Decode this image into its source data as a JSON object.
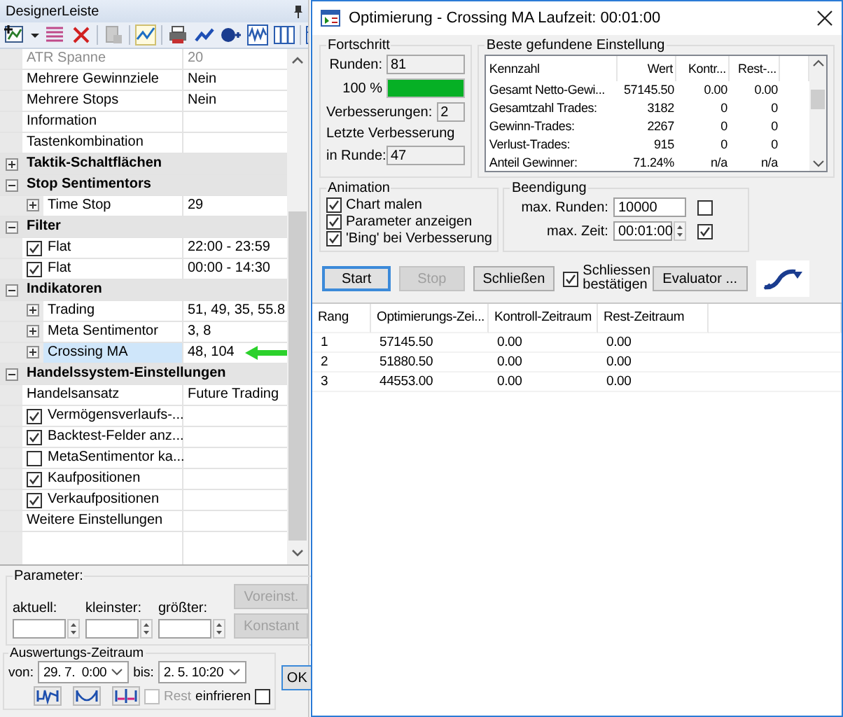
{
  "designer": {
    "title": "DesignerLeiste",
    "rows": [
      {
        "kind": "property",
        "name": "ATR Spanne",
        "value": "20",
        "disabled": true,
        "selected": false
      },
      {
        "kind": "property",
        "name": "Mehrere Gewinnziele",
        "value": "Nein",
        "disabled": false,
        "selected": false
      },
      {
        "kind": "property",
        "name": "Mehrere Stops",
        "value": "Nein",
        "disabled": false,
        "selected": false
      },
      {
        "kind": "property",
        "name": "Information",
        "disabled": false,
        "selected": false
      },
      {
        "kind": "property",
        "name": "Tastenkombination",
        "disabled": false,
        "selected": false
      },
      {
        "kind": "category",
        "label": "Taktik-Schaltflächen",
        "expanded": false
      },
      {
        "kind": "category",
        "label": "Stop Sentimentors",
        "expanded": true,
        "children": [
          {
            "kind": "expandable",
            "name": "Time Stop",
            "value": "29",
            "expanded": false,
            "selected": false,
            "pointed": false
          }
        ]
      },
      {
        "kind": "category",
        "label": "Filter",
        "expanded": true,
        "children": [
          {
            "kind": "check",
            "name": "Flat",
            "value": "22:00 - 23:59",
            "checked": true,
            "selected": false
          },
          {
            "kind": "check",
            "name": "Flat",
            "value": "00:00 - 14:30",
            "checked": true,
            "selected": false
          }
        ]
      },
      {
        "kind": "category",
        "label": "Indikatoren",
        "expanded": true,
        "children": [
          {
            "kind": "expandable",
            "name": "Trading",
            "value": "51, 49, 35, 55.8",
            "expanded": false,
            "selected": false,
            "pointed": false
          },
          {
            "kind": "expandable",
            "name": "Meta Sentimentor",
            "value": "3, 8",
            "expanded": false,
            "selected": false,
            "pointed": false
          },
          {
            "kind": "expandable",
            "name": "Crossing MA",
            "value": "48, 104",
            "expanded": false,
            "selected": true,
            "pointed": true
          }
        ]
      },
      {
        "kind": "category",
        "label": "Handelssystem-Einstellungen",
        "expanded": true,
        "children": [
          {
            "kind": "property",
            "name": "Handelsansatz",
            "value": "Future Trading",
            "disabled": false,
            "selected": false
          },
          {
            "kind": "check",
            "name": "Vermögensverlaufs-...",
            "checked": true,
            "selected": false
          },
          {
            "kind": "check",
            "name": "Backtest-Felder anz...",
            "checked": true,
            "selected": false
          },
          {
            "kind": "check",
            "name": "MetaSentimentor ka...",
            "checked": false,
            "selected": false
          },
          {
            "kind": "check",
            "name": "Kaufpositionen",
            "checked": true,
            "selected": false
          },
          {
            "kind": "check",
            "name": "Verkaufpositionen",
            "checked": true,
            "selected": false
          },
          {
            "kind": "property",
            "name": "Weitere Einstellungen",
            "disabled": false,
            "selected": false
          }
        ]
      }
    ],
    "parameter": {
      "title": "Parameter:",
      "fields": [
        {
          "label": "aktuell:"
        },
        {
          "label": "kleinster:"
        },
        {
          "label": "größter:"
        }
      ],
      "buttons": [
        {
          "label": "Voreinst.",
          "disabled": true
        },
        {
          "label": "Konstant",
          "disabled": true
        }
      ]
    },
    "period": {
      "title": "Auswertungs-Zeitraum",
      "from_label": "von:",
      "from": "29. 7.  0:00",
      "to_label": "bis:",
      "to": "2. 5. 10:20",
      "rest": {
        "label": "Rest",
        "checked": false,
        "disabled": true
      },
      "freeze": {
        "label": "einfrieren",
        "checked": false
      }
    },
    "ok_button": "OK"
  },
  "optimizer": {
    "title": "Optimierung - Crossing MA Laufzeit: 00:01:00",
    "progress": {
      "title": "Fortschritt",
      "rounds_label": "Runden:",
      "rounds": "81",
      "percent": "100 %",
      "level": 1,
      "improvements_label": "Verbesserungen:",
      "improvements": "2",
      "last_label": "Letzte Verbesserung",
      "in_round_label": "in Runde:",
      "in_round": "47"
    },
    "best": {
      "title": "Beste gefundene Einstellung",
      "columns": [
        "Kennzahl",
        "Wert",
        "Kontr...",
        "Rest-..."
      ],
      "rows": [
        [
          "Gesamt Netto-Gewi...",
          "57145.50",
          "0.00",
          "0.00"
        ],
        [
          "Gesamtzahl Trades:",
          "3182",
          "0",
          "0"
        ],
        [
          "Gewinn-Trades:",
          "2267",
          "0",
          "0"
        ],
        [
          "Verlust-Trades:",
          "915",
          "0",
          "0"
        ],
        [
          "Anteil Gewinner:",
          "71.24%",
          "n/a",
          "n/a"
        ]
      ]
    },
    "animation": {
      "title": "Animation",
      "options": [
        {
          "label": "Chart malen",
          "checked": true
        },
        {
          "label": "Parameter anzeigen",
          "checked": true
        },
        {
          "label": "'Bing' bei Verbesserung",
          "checked": true
        }
      ]
    },
    "termination": {
      "title": "Beendigung",
      "max_rounds_label": "max. Runden:",
      "max_rounds": "10000",
      "max_rounds_on": false,
      "max_time_label": "max. Zeit:",
      "max_time": "00:01:00",
      "max_time_on": true
    },
    "buttons": [
      {
        "kind": "button",
        "label": "Start",
        "focused": true,
        "disabled": false
      },
      {
        "kind": "button",
        "label": "Stop",
        "focused": false,
        "disabled": true
      },
      {
        "kind": "button",
        "label": "Schließen",
        "focused": false,
        "disabled": false
      },
      {
        "kind": "check",
        "label": "Schliessen bestätigen",
        "checked": true
      },
      {
        "kind": "button",
        "label": "Evaluator ...",
        "focused": false,
        "disabled": false
      },
      {
        "kind": "logo"
      }
    ],
    "results": {
      "columns": [
        "Rang",
        "Optimierungs-Zei...",
        "Kontroll-Zeitraum",
        "Rest-Zeitraum"
      ],
      "rows": [
        [
          "1",
          "57145.50",
          "0.00",
          "0.00"
        ],
        [
          "2",
          "51880.50",
          "0.00",
          "0.00"
        ],
        [
          "3",
          "44553.00",
          "0.00",
          "0.00"
        ]
      ]
    }
  }
}
